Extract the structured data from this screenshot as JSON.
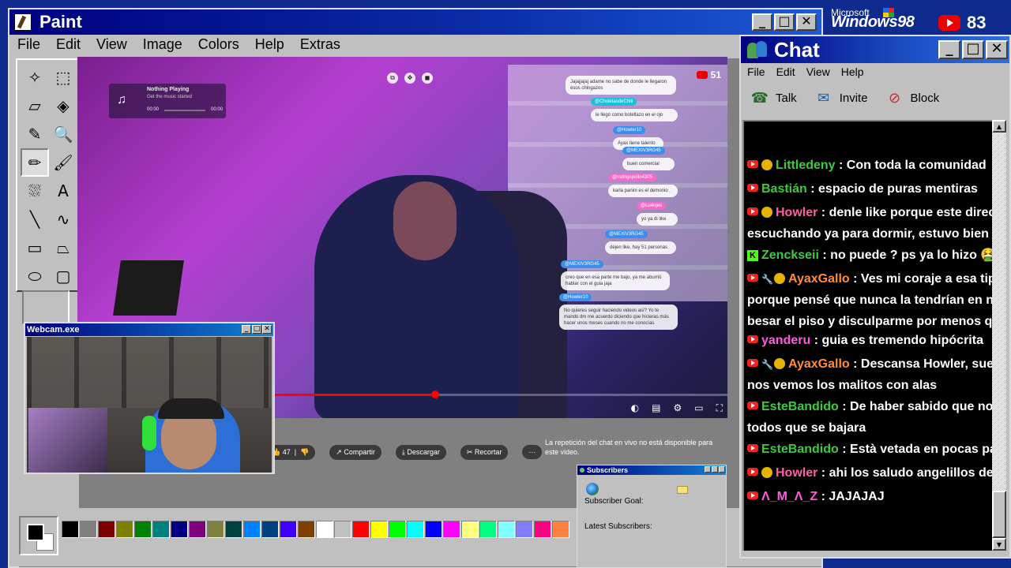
{
  "paint": {
    "title": "Paint",
    "menu": [
      "File",
      "Edit",
      "View",
      "Image",
      "Colors",
      "Help",
      "Extras"
    ],
    "palette": [
      "#000000",
      "#808080",
      "#800000",
      "#808000",
      "#008000",
      "#008080",
      "#000080",
      "#800080",
      "#808040",
      "#004040",
      "#0080ff",
      "#004080",
      "#4000ff",
      "#804000",
      "#ffffff",
      "#c0c0c0",
      "#ff0000",
      "#ffff00",
      "#00ff00",
      "#00ffff",
      "#0000ff",
      "#ff00ff",
      "#ffff80",
      "#00ff80",
      "#80ffff",
      "#8080ff",
      "#ff0080",
      "#ff8040"
    ]
  },
  "video": {
    "now_playing_title": "Nothing Playing",
    "now_playing_sub": "Get the music started",
    "time_start": "00:00",
    "time_end": "00:00",
    "viewers": "51",
    "progress_fraction": 0.55,
    "bubbles": [
      {
        "text": "Jajajjajaj adame no sabe de donde le llegaron esos chingazos"
      },
      {
        "user": "@ChuletasdeChili",
        "text": "le llegó como botellazo en el ojo",
        "color": "cyan"
      },
      {
        "user": "@Howler10",
        "text": "Ayax tiene talento",
        "color": "blue"
      },
      {
        "user": "@MEXIV3RG45",
        "text": "buen comercial",
        "color": "blue"
      },
      {
        "user": "@rodrigopollo4305",
        "text": "karla panini es el demonio",
        "color": "pink"
      },
      {
        "user": "@Lu4njes",
        "text": "yo ya di like",
        "color": "pink"
      },
      {
        "user": "@MEXIV3RG45",
        "text": "dejen like, hay 51 personas",
        "color": "blue"
      },
      {
        "user": "@MEXIV3RG45",
        "text": "creo que en esa parte me bajo, ya me aburrió hablar con el guia jaja",
        "color": "blue"
      },
      {
        "user": "@Howler10",
        "text": "No quieres seguir haciendo videos así? Yo te mando dm me acuerdo diciendo que hicieras más hacer unos meses cuando no me conocías",
        "color": "blue"
      }
    ],
    "below": {
      "likes": "47",
      "share": "Compartir",
      "download": "Descargar",
      "clip": "Recortar",
      "more": "···",
      "chat_note": "La repetición del chat en vivo no está disponible para este video."
    }
  },
  "webcam": {
    "title": "Webcam.exe"
  },
  "subscribers": {
    "title": "Subscribers",
    "goal_label": "Subscriber Goal:",
    "latest_label": "Latest Subscribers:"
  },
  "branding": {
    "microsoft": "Microsoft",
    "windows": "Windows98",
    "viewer_count": "83"
  },
  "chat": {
    "title": "Chat",
    "menu": [
      "File",
      "Edit",
      "View",
      "Help"
    ],
    "tools": {
      "talk": "Talk",
      "invite": "Invite",
      "block": "Block"
    },
    "messages": [
      {
        "user": "Littledeny",
        "color": "green",
        "badge": true,
        "text": ": Con toda la comunidad"
      },
      {
        "user": "Bastián",
        "color": "green",
        "badge": false,
        "text": ": espacio de puras mentiras"
      },
      {
        "user": "Howler",
        "color": "pink",
        "badge": true,
        "text": ": denle like porque este directo se",
        "text2": "escuchando ya para dormir, estuvo bien tu dire"
      },
      {
        "user": "Zenckseii",
        "color": "green",
        "kick": true,
        "text": ": no puede ? ps ya lo hizo 🤮 no p"
      },
      {
        "user": "AyaxGallo",
        "color": "orange",
        "badge": true,
        "mod": true,
        "text": ": Ves mi coraje a esa tipa le c",
        "text2": "porque pensé que nunca la tendrían en nuestra",
        "text3": "besar el piso y disculparme por menos que eso"
      },
      {
        "user": "yanderu",
        "color": "magenta",
        "badge": false,
        "text": ": guia es tremendo hipócrita"
      },
      {
        "user": "AyaxGallo",
        "color": "orange",
        "badge": true,
        "mod": true,
        "text": ": Descansa Howler, sueña co",
        "text2": "nos vemos los malitos con alas"
      },
      {
        "user": "EsteBandido",
        "color": "green",
        "badge": false,
        "text": ": De haber sabido que no estab",
        "text2": "todos que se bajara"
      },
      {
        "user": "EsteBandido",
        "color": "green",
        "badge": false,
        "text": ": Està vetada en pocas palabra"
      },
      {
        "user": "Howler",
        "color": "pink",
        "badge": true,
        "text": ": ahi los saludo angelillos del seño"
      },
      {
        "user": "Λ_M_Λ_Z",
        "color": "magenta",
        "badge": false,
        "text": ": JAJAJAJ"
      }
    ]
  }
}
